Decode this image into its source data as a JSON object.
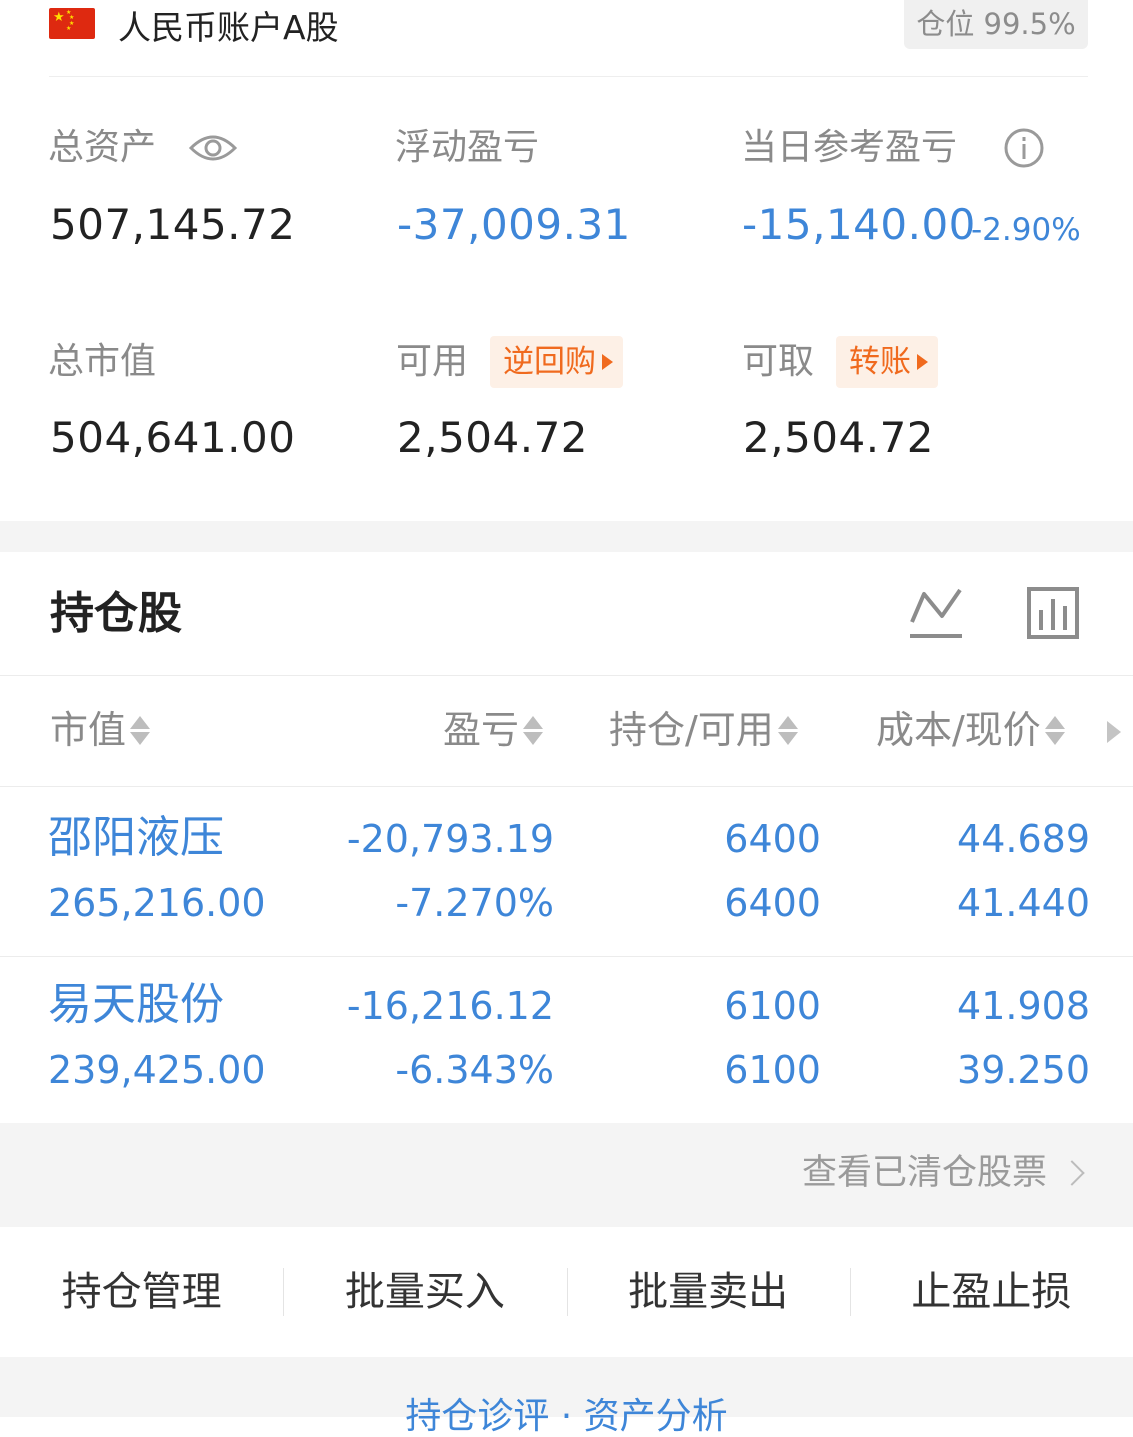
{
  "account": {
    "title": "人民币账户A股",
    "position_label": "仓位 99.5%",
    "flag": "china-flag"
  },
  "summary": {
    "total_assets_label": "总资产",
    "total_assets": "507,145.72",
    "floating_pl_label": "浮动盈亏",
    "floating_pl": "-37,009.31",
    "daily_pl_label": "当日参考盈亏",
    "daily_pl": "-15,140.00",
    "daily_pl_pct": "-2.90%",
    "market_value_label": "总市值",
    "market_value": "504,641.00",
    "available_label": "可用",
    "available": "2,504.72",
    "reverse_repo_label": "逆回购",
    "withdrawable_label": "可取",
    "withdrawable": "2,504.72",
    "transfer_label": "转账"
  },
  "holdings": {
    "title": "持仓股",
    "columns": [
      "市值",
      "盈亏",
      "持仓/可用",
      "成本/现价"
    ],
    "rows": [
      {
        "name": "邵阳液压",
        "market_value": "265,216.00",
        "pl": "-20,793.19",
        "pl_pct": "-7.270%",
        "position": "6400",
        "available": "6400",
        "cost": "44.689",
        "price": "41.440"
      },
      {
        "name": "易天股份",
        "market_value": "239,425.00",
        "pl": "-16,216.12",
        "pl_pct": "-6.343%",
        "position": "6100",
        "available": "6100",
        "cost": "41.908",
        "price": "39.250"
      }
    ],
    "cleared_link": "查看已清仓股票"
  },
  "actions": [
    "持仓管理",
    "批量买入",
    "批量卖出",
    "止盈止损"
  ],
  "bottom": {
    "partial_text": "持仓诊评 · 资产分析"
  },
  "colors": {
    "blue": "#3e86d8",
    "orange": "#f06a1e",
    "tag_bg": "#fdf0e6",
    "gray_text": "#8a8a8a",
    "band": "#f4f4f4"
  }
}
